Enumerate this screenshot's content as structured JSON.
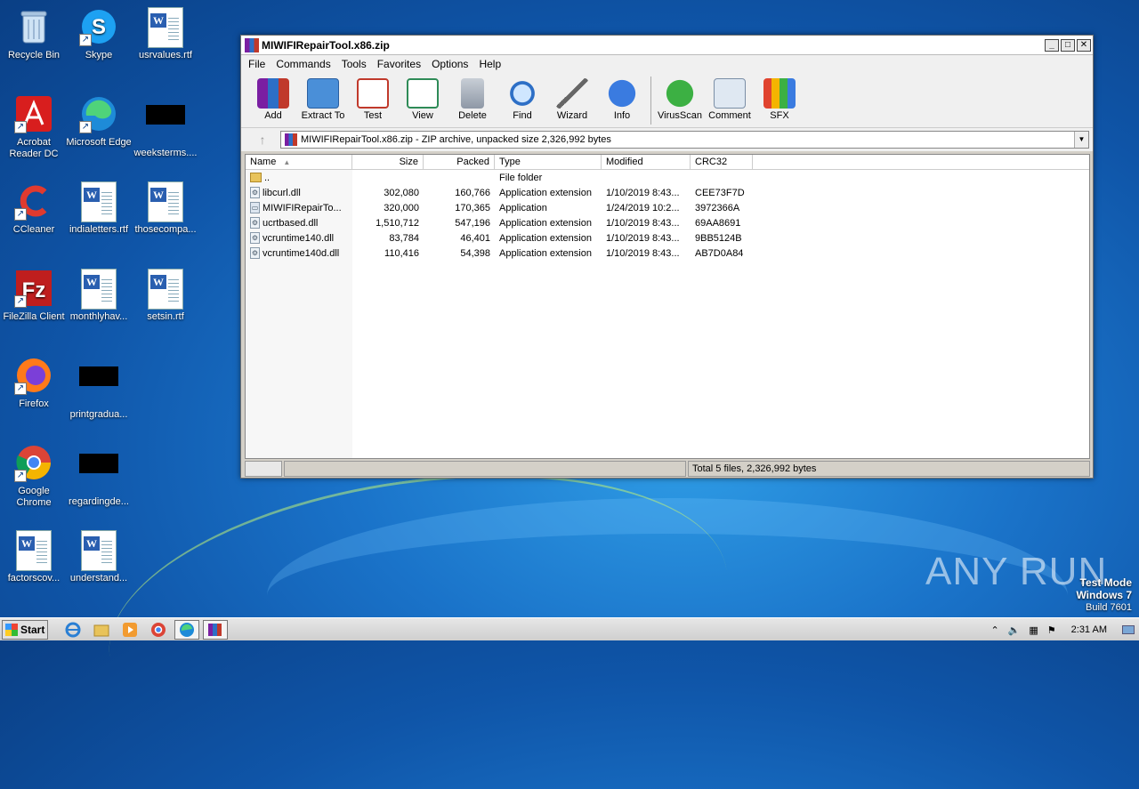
{
  "desktop": {
    "icons": [
      {
        "label": "Recycle Bin"
      },
      {
        "label": "Skype"
      },
      {
        "label": "usrvalues.rtf"
      },
      {
        "label": "Acrobat Reader DC"
      },
      {
        "label": "Microsoft Edge"
      },
      {
        "label": "weeksterms...."
      },
      {
        "label": "CCleaner"
      },
      {
        "label": "indialetters.rtf"
      },
      {
        "label": "thosecompa..."
      },
      {
        "label": "FileZilla Client"
      },
      {
        "label": "monthlyhav..."
      },
      {
        "label": "setsin.rtf"
      },
      {
        "label": "Firefox"
      },
      {
        "label": "printgradua..."
      },
      {
        "label": "Google Chrome"
      },
      {
        "label": "regardingde..."
      },
      {
        "label": "factorscov..."
      },
      {
        "label": "understand..."
      }
    ]
  },
  "window": {
    "title": "MIWIFIRepairTool.x86.zip",
    "menu": [
      "File",
      "Commands",
      "Tools",
      "Favorites",
      "Options",
      "Help"
    ],
    "toolbar": [
      "Add",
      "Extract To",
      "Test",
      "View",
      "Delete",
      "Find",
      "Wizard",
      "Info",
      "VirusScan",
      "Comment",
      "SFX"
    ],
    "address": "MIWIFIRepairTool.x86.zip - ZIP archive, unpacked size 2,326,992 bytes",
    "columns": [
      "Name",
      "Size",
      "Packed",
      "Type",
      "Modified",
      "CRC32"
    ],
    "rows": [
      {
        "name": "..",
        "size": "",
        "packed": "",
        "type": "File folder",
        "modified": "",
        "crc": ""
      },
      {
        "name": "libcurl.dll",
        "size": "302,080",
        "packed": "160,766",
        "type": "Application extension",
        "modified": "1/10/2019 8:43...",
        "crc": "CEE73F7D"
      },
      {
        "name": "MIWIFIRepairTo...",
        "size": "320,000",
        "packed": "170,365",
        "type": "Application",
        "modified": "1/24/2019 10:2...",
        "crc": "3972366A"
      },
      {
        "name": "ucrtbased.dll",
        "size": "1,510,712",
        "packed": "547,196",
        "type": "Application extension",
        "modified": "1/10/2019 8:43...",
        "crc": "69AA8691"
      },
      {
        "name": "vcruntime140.dll",
        "size": "83,784",
        "packed": "46,401",
        "type": "Application extension",
        "modified": "1/10/2019 8:43...",
        "crc": "9BB5124B"
      },
      {
        "name": "vcruntime140d.dll",
        "size": "110,416",
        "packed": "54,398",
        "type": "Application extension",
        "modified": "1/10/2019 8:43...",
        "crc": "AB7D0A84"
      }
    ],
    "status": "Total 5 files, 2,326,992 bytes"
  },
  "taskbar": {
    "start": "Start",
    "clock": "2:31 AM"
  },
  "watermark": {
    "line1": "Test Mode",
    "line2": "Windows 7",
    "line3": "Build 7601",
    "brand": "ANY RUN"
  }
}
